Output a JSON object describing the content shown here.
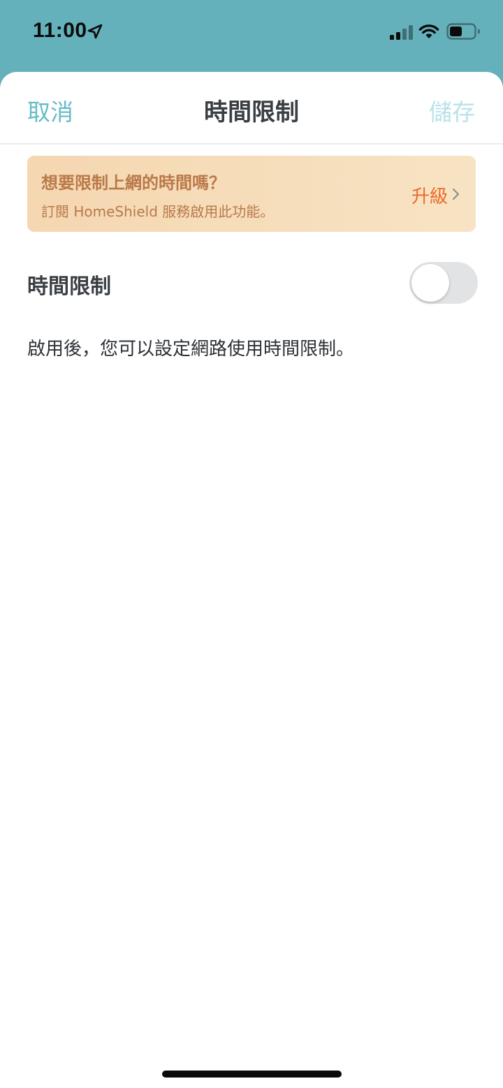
{
  "status_bar": {
    "time": "11:00",
    "icons": [
      "location-arrow-icon",
      "cellular-signal-icon",
      "wifi-icon",
      "battery-icon"
    ]
  },
  "nav": {
    "cancel_label": "取消",
    "title": "時間限制",
    "save_label": "儲存"
  },
  "promo": {
    "title": "想要限制上網的時間嗎？",
    "subtitle": "訂閱 HomeShield 服務啟用此功能。",
    "upgrade_label": "升級",
    "icon": "chevron-right-icon"
  },
  "setting": {
    "label": "時間限制",
    "enabled": false,
    "description": "啟用後，您可以設定網路使用時間限制。"
  },
  "colors": {
    "header_bg": "#65b1bb",
    "accent": "#66bcc6",
    "accent_disabled": "#b9e2e8",
    "promo_text": "#b9794a",
    "promo_link": "#ea6b2a",
    "toggle_off": "#e1e3e5"
  }
}
